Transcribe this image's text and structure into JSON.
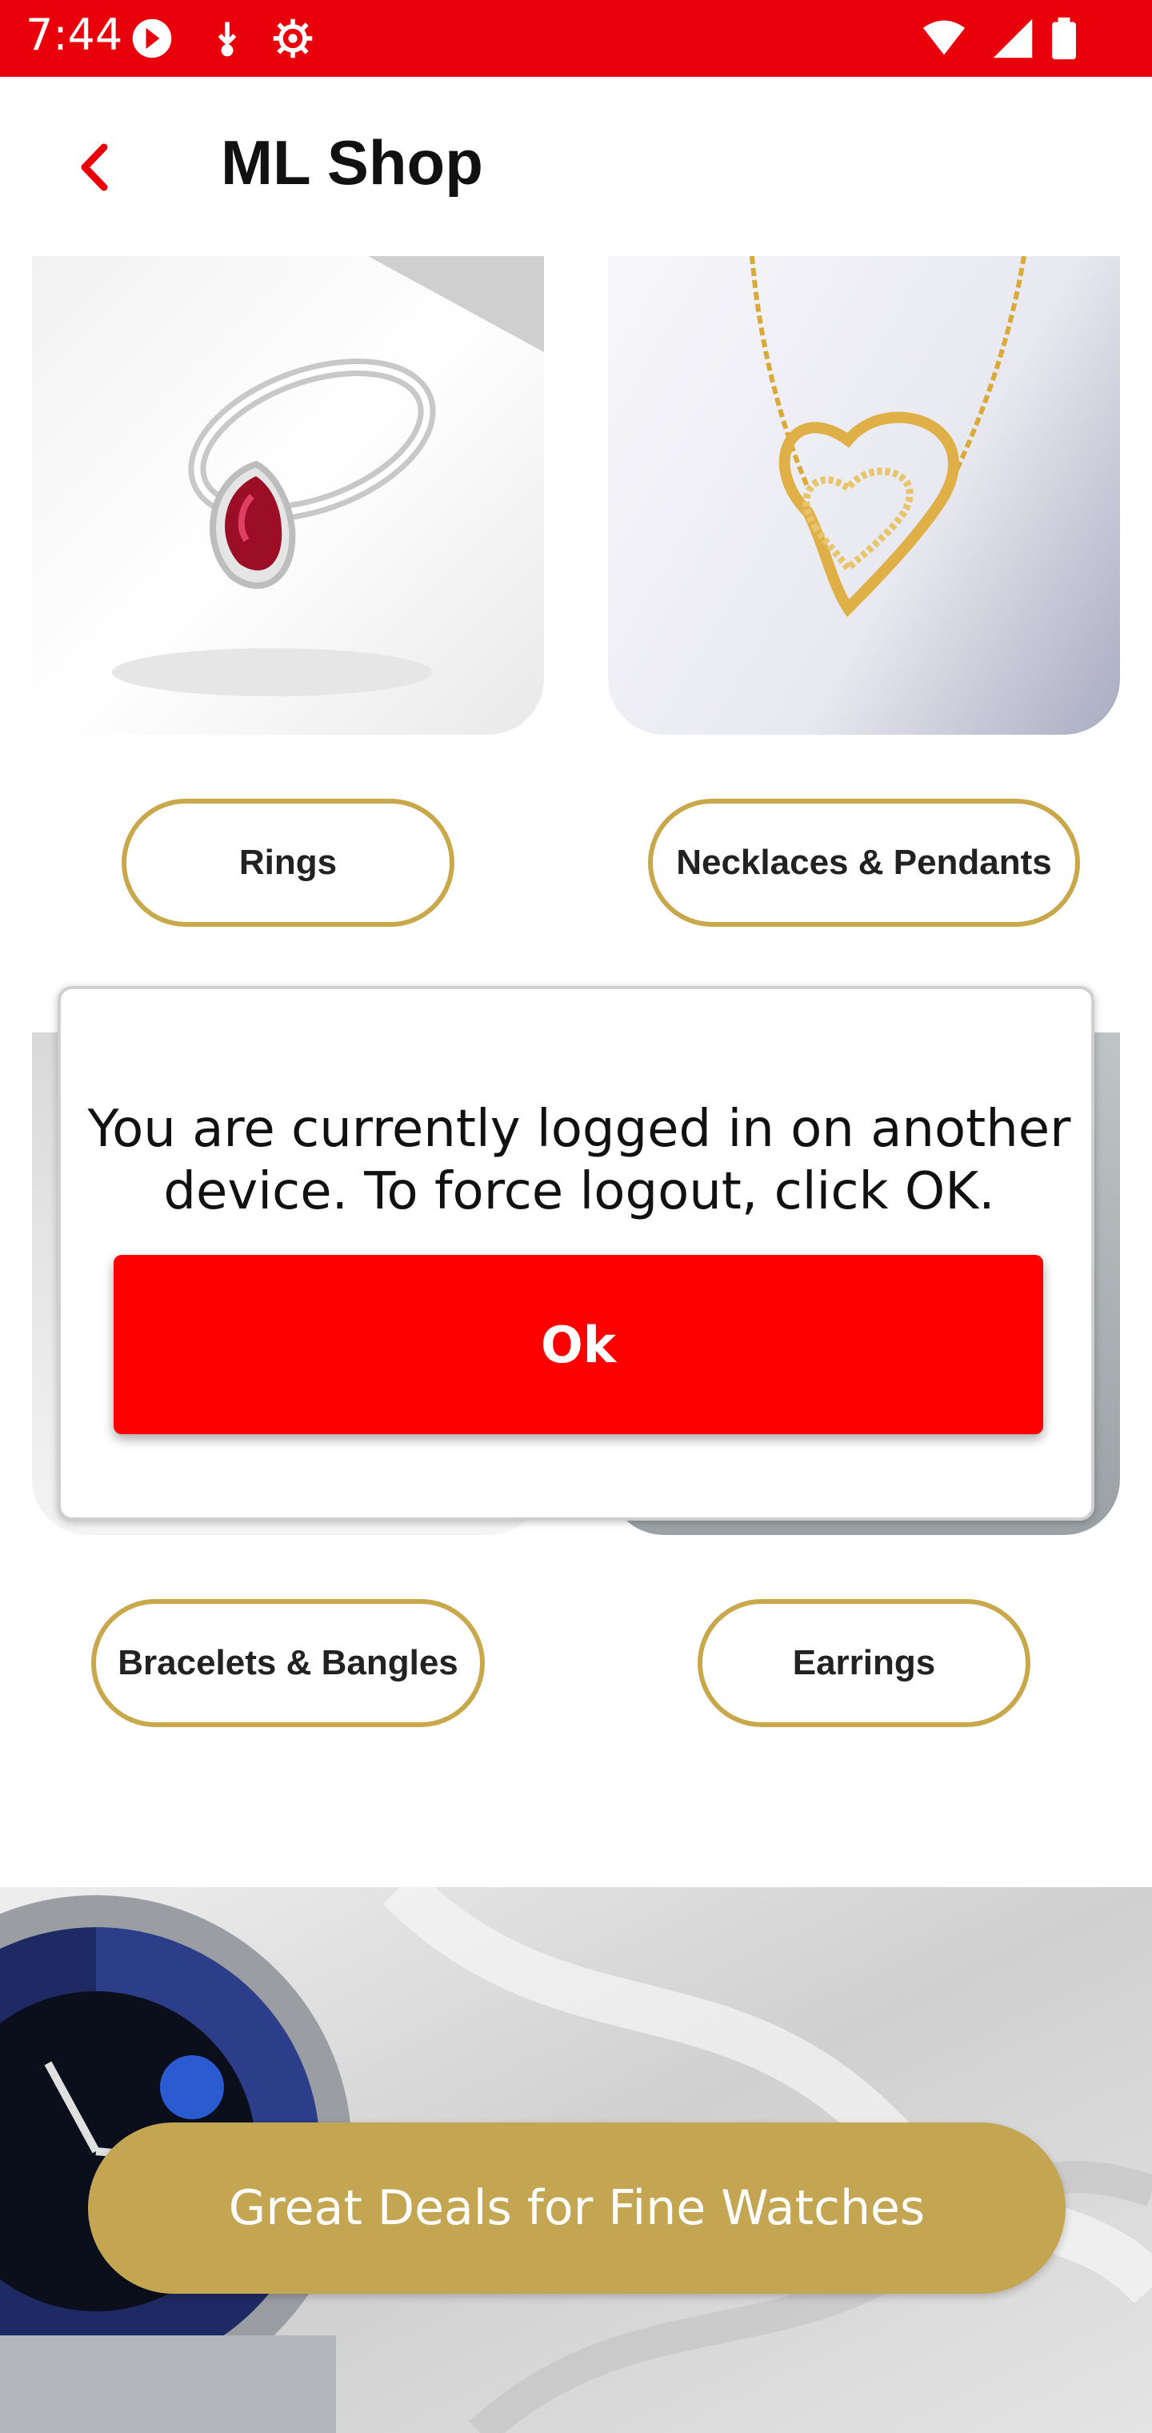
{
  "status_bar": {
    "time": "7:44",
    "icons": [
      "app-notification-icon",
      "download-icon",
      "settings-icon",
      "wifi-icon",
      "signal-icon",
      "battery-icon"
    ]
  },
  "app_bar": {
    "title": "ML Shop",
    "back_icon": "chevron-left-icon"
  },
  "categories": [
    {
      "label": "Rings",
      "image": "ruby-ring-image"
    },
    {
      "label": "Necklaces & Pendants",
      "image": "gold-heart-necklace-image"
    },
    {
      "label": "Bracelets & Bangles",
      "image": "bracelet-image"
    },
    {
      "label": "Earrings",
      "image": "earrings-image"
    }
  ],
  "dialog": {
    "message": "You are currently logged in on another device. To force logout, click OK.",
    "ok_label": "Ok"
  },
  "banner": {
    "image": "luxury-watch-image",
    "button_label": "Great Deals for Fine Watches"
  },
  "colors": {
    "status_bar": "#e8000a",
    "accent_gold": "#c9a84c",
    "ok_button": "#fe0000",
    "banner_button": "#c4a552"
  }
}
